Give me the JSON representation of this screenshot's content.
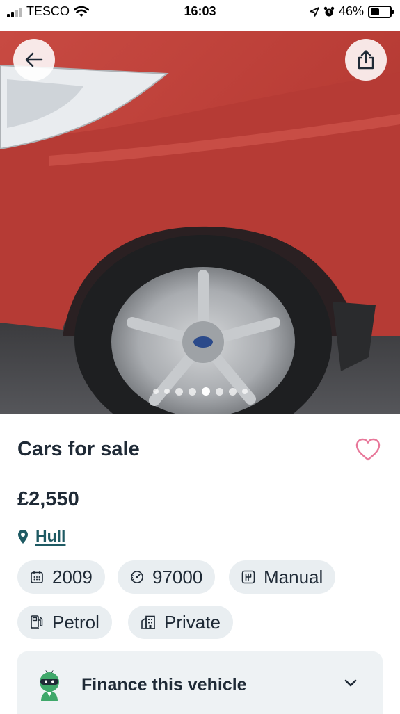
{
  "status_bar": {
    "carrier": "TESCO",
    "time": "16:03",
    "battery": "46%",
    "battery_level": 0.46,
    "icons": [
      "signal-bars-icon",
      "wifi-icon",
      "location-arrow-icon",
      "alarm-clock-icon",
      "battery-icon"
    ]
  },
  "gallery": {
    "image_subject": "red car front wheel",
    "total_images": 8,
    "active_index": 4,
    "buttons": {
      "back_icon": "arrow-left-icon",
      "share_icon": "share-icon"
    }
  },
  "listing": {
    "title": "Cars for sale",
    "price": "£2,550",
    "location": "Hull",
    "favorite_icon": "heart-outline-icon"
  },
  "specs": [
    {
      "label": "2009",
      "icon": "calendar-icon"
    },
    {
      "label": "97000",
      "icon": "speedometer-icon"
    },
    {
      "label": "Manual",
      "icon": "gearbox-icon"
    },
    {
      "label": "Petrol",
      "icon": "fuel-pump-icon"
    },
    {
      "label": "Private",
      "icon": "building-icon"
    }
  ],
  "finance": {
    "label": "Finance this vehicle",
    "icon": "ninja-mascot-icon",
    "expand_icon": "chevron-down-icon"
  },
  "colors": {
    "text_primary": "#1f2a36",
    "link": "#1e5a63",
    "chip_bg": "#e9eef1",
    "heart": "#e8789a",
    "mascot_green": "#3fa86a"
  }
}
